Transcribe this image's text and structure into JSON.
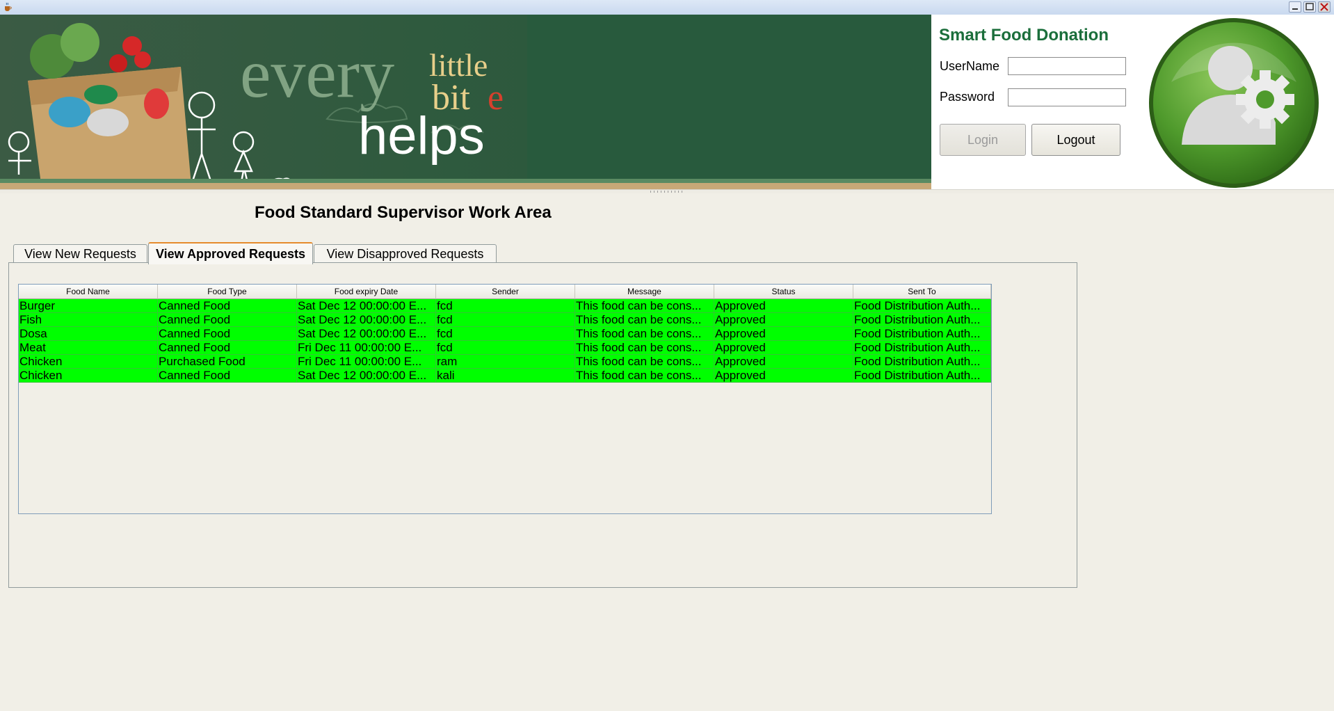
{
  "window": {
    "icon": "java-cup-icon",
    "controls": [
      "minimize-icon",
      "maximize-icon",
      "close-icon"
    ]
  },
  "banner": {
    "line1_word1": "every",
    "line1_word2": "little",
    "line1_word3_a": "bit",
    "line1_word3_b": "e",
    "line2": "helps"
  },
  "login": {
    "title": "Smart Food Donation",
    "username_label": "UserName",
    "username_value": "",
    "password_label": "Password",
    "password_value": "",
    "login_label": "Login",
    "logout_label": "Logout",
    "avatar_icon": "user-gear-icon",
    "brand_color": "#1b6e3b"
  },
  "work_area": {
    "title": "Food Standard Supervisor Work Area",
    "tabs": [
      {
        "label": "View New Requests",
        "active": false
      },
      {
        "label": "View Approved Requests",
        "active": true
      },
      {
        "label": "View Disapproved Requests",
        "active": false
      }
    ]
  },
  "table": {
    "columns": [
      "Food Name",
      "Food Type",
      "Food expiry Date",
      "Sender",
      "Message",
      "Status",
      "Sent To"
    ],
    "row_color": "#00ff00",
    "rows": [
      [
        "Burger",
        "Canned Food",
        "Sat Dec 12 00:00:00 E...",
        "fcd",
        "This food can be cons...",
        "Approved",
        "Food Distribution Auth..."
      ],
      [
        "Fish",
        "Canned Food",
        "Sat Dec 12 00:00:00 E...",
        "fcd",
        "This food can be cons...",
        "Approved",
        "Food Distribution Auth..."
      ],
      [
        "Dosa",
        "Canned Food",
        "Sat Dec 12 00:00:00 E...",
        "fcd",
        "This food can be cons...",
        "Approved",
        "Food Distribution Auth..."
      ],
      [
        "Meat",
        "Canned Food",
        "Fri Dec 11 00:00:00 E...",
        "fcd",
        "This food can be cons...",
        "Approved",
        "Food Distribution Auth..."
      ],
      [
        "Chicken",
        "Purchased Food",
        "Fri Dec 11 00:00:00 E...",
        "ram",
        "This food can be cons...",
        "Approved",
        "Food Distribution Auth..."
      ],
      [
        "Chicken",
        "Canned Food",
        "Sat Dec 12 00:00:00 E...",
        "kali",
        "This food can be cons...",
        "Approved",
        "Food Distribution Auth..."
      ]
    ]
  }
}
